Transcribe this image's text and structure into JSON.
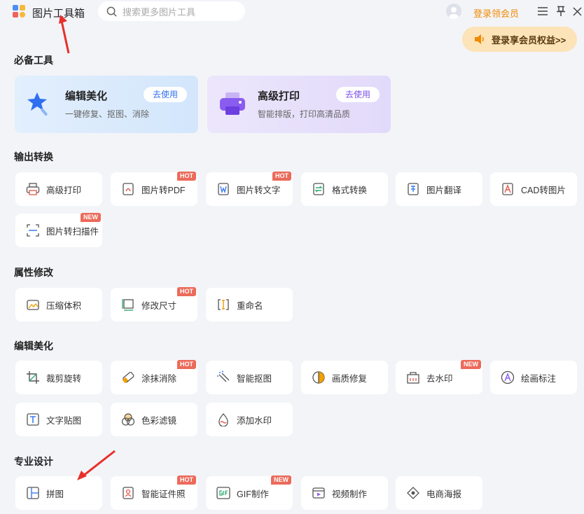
{
  "header": {
    "app_title": "图片工具箱",
    "search_placeholder": "搜索更多图片工具",
    "login_label": "登录领会员",
    "vip_label": "登录享会员权益>>"
  },
  "colors": {
    "accent": "#f08a00",
    "badge": "#ec6a5a",
    "vip_bg": "#fce3b8",
    "blue_card": "#dcebfc",
    "purple_card": "#e8e2fb"
  },
  "sections": {
    "essential": "必备工具",
    "convert": "输出转换",
    "attr": "属性修改",
    "edit": "编辑美化",
    "design": "专业设计"
  },
  "featured": [
    {
      "title": "编辑美化",
      "desc": "一键修复、抠图、消除",
      "action": "去使用"
    },
    {
      "title": "高级打印",
      "desc": "智能排版，打印高清品质",
      "action": "去使用"
    }
  ],
  "tools": {
    "convert": [
      {
        "label": "高级打印",
        "icon": "printer-icon",
        "badge": ""
      },
      {
        "label": "图片转PDF",
        "icon": "pdf-icon",
        "badge": "HOT"
      },
      {
        "label": "图片转文字",
        "icon": "word-icon",
        "badge": "HOT"
      },
      {
        "label": "格式转换",
        "icon": "convert-icon",
        "badge": ""
      },
      {
        "label": "图片翻译",
        "icon": "translate-icon",
        "badge": ""
      },
      {
        "label": "CAD转图片",
        "icon": "cad-icon",
        "badge": ""
      },
      {
        "label": "图片转扫描件",
        "icon": "scan-icon",
        "badge": "NEW"
      }
    ],
    "attr": [
      {
        "label": "压缩体积",
        "icon": "compress-icon",
        "badge": ""
      },
      {
        "label": "修改尺寸",
        "icon": "resize-icon",
        "badge": "HOT"
      },
      {
        "label": "重命名",
        "icon": "rename-icon",
        "badge": ""
      }
    ],
    "edit": [
      {
        "label": "裁剪旋转",
        "icon": "crop-icon",
        "badge": ""
      },
      {
        "label": "涂抹消除",
        "icon": "eraser-icon",
        "badge": "HOT"
      },
      {
        "label": "智能抠图",
        "icon": "cutout-icon",
        "badge": ""
      },
      {
        "label": "画质修复",
        "icon": "quality-icon",
        "badge": ""
      },
      {
        "label": "去水印",
        "icon": "remove-watermark-icon",
        "badge": "NEW"
      },
      {
        "label": "绘画标注",
        "icon": "annotate-icon",
        "badge": ""
      },
      {
        "label": "文字贴图",
        "icon": "text-icon",
        "badge": ""
      },
      {
        "label": "色彩滤镜",
        "icon": "filter-icon",
        "badge": ""
      },
      {
        "label": "添加水印",
        "icon": "watermark-icon",
        "badge": ""
      }
    ],
    "design": [
      {
        "label": "拼图",
        "icon": "collage-icon",
        "badge": ""
      },
      {
        "label": "智能证件照",
        "icon": "id-photo-icon",
        "badge": "HOT"
      },
      {
        "label": "GIF制作",
        "icon": "gif-icon",
        "badge": "NEW"
      },
      {
        "label": "视频制作",
        "icon": "video-icon",
        "badge": ""
      },
      {
        "label": "电商海报",
        "icon": "poster-icon",
        "badge": ""
      }
    ]
  }
}
